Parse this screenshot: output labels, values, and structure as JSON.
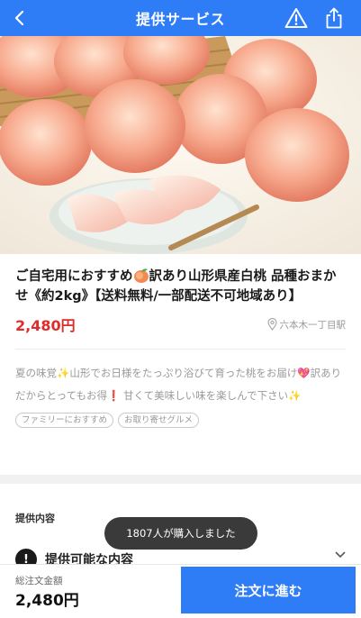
{
  "header": {
    "title": "提供サービス",
    "back_icon": "chevron-left-icon",
    "warning_icon": "warning-icon",
    "share_icon": "share-icon"
  },
  "hero": {
    "icon": "peach-photo"
  },
  "product": {
    "title_part1": "ご自宅用におすすめ",
    "title_emoji": "peach-emoji",
    "title_part2": "訳あり山形県産白桃 品種おまかせ《約2kg》【送料無料/一部配送不可地域あり】",
    "price": "2,480円",
    "location": "六本木一丁目駅"
  },
  "description": {
    "part1": "夏の味覚",
    "sparkle1": "✨",
    "part2": "山形でお日様をたっぷり浴びて育った桃をお届け",
    "heart": "💖",
    "part3": "訳ありだからとってもお得",
    "exclaim": "❗",
    "part4": " 甘くて美味しい味を楽しんで下さい",
    "sparkle2": "✨"
  },
  "tags": [
    "ファミリーにおすすめ",
    "お取り寄せグルメ"
  ],
  "section": {
    "title": "提供内容",
    "partial_item": "提供可能な内容"
  },
  "toast": {
    "text": "1807人が購入しました"
  },
  "bottom_bar": {
    "total_label": "総注文金額",
    "total_value": "2,480円",
    "order_button": "注文に進む"
  },
  "colors": {
    "brand": "#2f7df6",
    "price": "#e02b2b"
  }
}
